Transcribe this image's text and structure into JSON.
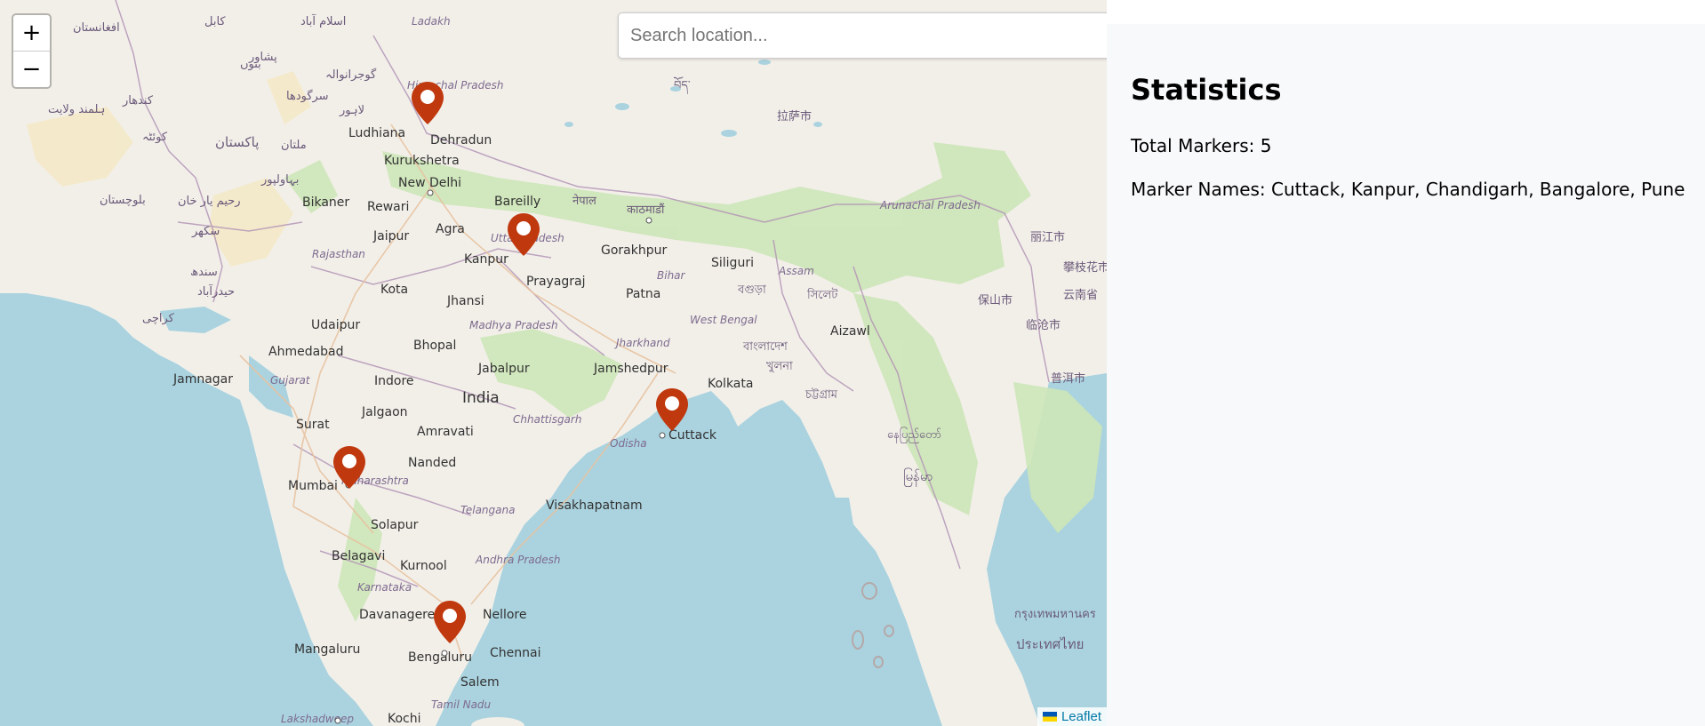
{
  "search": {
    "placeholder": "Search location..."
  },
  "zoom": {
    "in_label": "+",
    "out_label": "−"
  },
  "attribution": {
    "label": "Leaflet"
  },
  "map_labels": {
    "cities": [
      "Ludhiana",
      "Dehradun",
      "Kurukshetra",
      "New Delhi",
      "Bareilly",
      "Bikaner",
      "Rewari",
      "Jaipur",
      "Agra",
      "Kanpur",
      "Gorakhpur",
      "Siliguri",
      "Prayagraj",
      "Kota",
      "Jhansi",
      "Patna",
      "Udaipur",
      "Ahmedabad",
      "Bhopal",
      "Jamshedpur",
      "Kolkata",
      "Jamnagar",
      "Indore",
      "Jabalpur",
      "India",
      "Surat",
      "Jalgaon",
      "Amravati",
      "Cuttack",
      "Nanded",
      "Mumbai",
      "Visakhapatnam",
      "Solapur",
      "Belagavi",
      "Kurnool",
      "Davanagere",
      "Nellore",
      "Mangaluru",
      "Bengaluru",
      "Chennai",
      "Salem",
      "Kochi",
      "Aizawl"
    ],
    "regions": [
      "Ladakh",
      "Rajasthan",
      "Madhya Pradesh",
      "Gujarat",
      "Bihar",
      "Jharkhand",
      "West Bengal",
      "Assam",
      "Arunachal Pradesh",
      "Chhattisgarh",
      "Odisha",
      "Telangana",
      "Andhra Pradesh",
      "Karnataka",
      "Tamil Nadu",
      "Lakshadweep",
      "Maharashtra",
      "Uttar Pradesh",
      "Himachal Pradesh"
    ],
    "foreign": [
      "افغانستان",
      "کابل",
      "اسلام آباد",
      "پشاور",
      "بنوں",
      "گوجرانوالہ",
      "سرگودھا",
      "لاہور",
      "کندھار",
      "ہلمند ولایت",
      "کوئٹہ",
      "پاکستان",
      "ملتان",
      "بہاولپور",
      "بلوچستان",
      "رحیم یار خان",
      "سکھر",
      "سندھ",
      "حیدرآباد",
      "کراچی",
      "नेपाल",
      "काठमाडौं",
      "拉萨市",
      "བོད་",
      "বাংলাদেশ",
      "খুলনা",
      "চট্টগ্রাম",
      "সিলেট",
      "বগুড়া",
      "မြန်မာ",
      "နေပြည်တော်",
      "丽江市",
      "保山市",
      "临沧市",
      "普洱市",
      "云南省",
      "攀枝花市",
      "ประเทศไทย",
      "กรุงเทพมหานคร"
    ]
  },
  "markers": [
    {
      "name": "Chandigarh",
      "icon": "map-pin-icon"
    },
    {
      "name": "Kanpur",
      "icon": "map-pin-icon"
    },
    {
      "name": "Cuttack",
      "icon": "map-pin-icon"
    },
    {
      "name": "Pune",
      "icon": "map-pin-icon"
    },
    {
      "name": "Bangalore",
      "icon": "map-pin-icon"
    }
  ],
  "stats": {
    "title": "Statistics",
    "total_label": "Total Markers: 5",
    "names_label": "Marker Names: Cuttack, Kanpur, Chandigarh, Bangalore, Pune"
  },
  "colors": {
    "marker": "#c0390e",
    "sea": "#aad3df",
    "land": "#f2efe9",
    "panel_bg": "#f8f9fa",
    "attribution_link": "#0078a8"
  }
}
